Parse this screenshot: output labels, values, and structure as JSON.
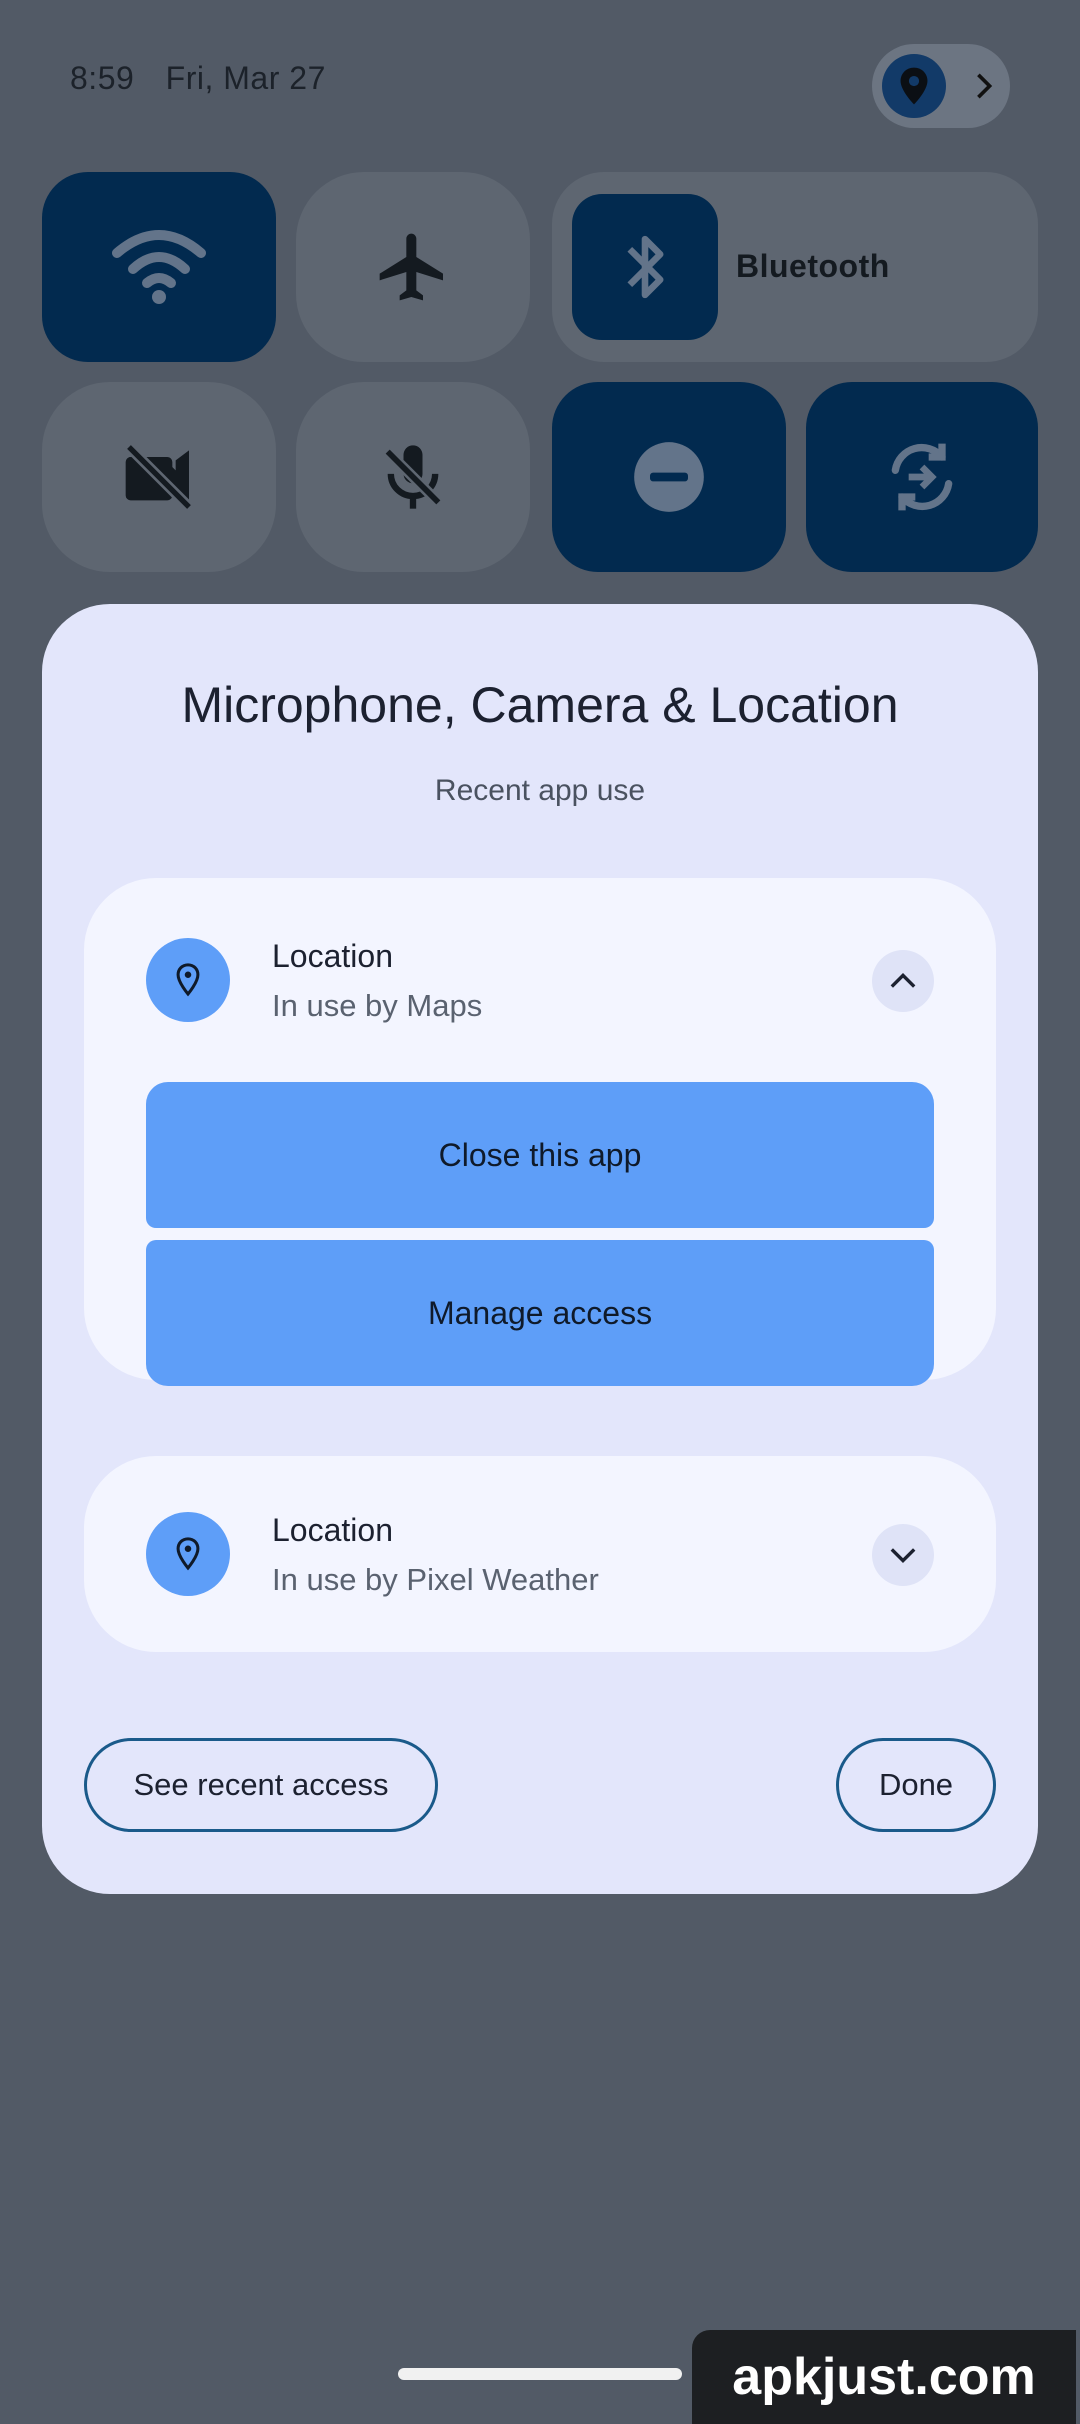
{
  "status_bar": {
    "time": "8:59",
    "date": "Fri, Mar 27"
  },
  "privacy_chip": {
    "icon": "location-pin-icon",
    "chevron": "chevron-right-icon"
  },
  "quick_tiles": [
    {
      "name": "wifi",
      "icon": "wifi-icon",
      "active": true
    },
    {
      "name": "airplane-mode",
      "icon": "airplane-icon",
      "active": false
    },
    {
      "name": "bluetooth",
      "icon": "bluetooth-icon",
      "label": "Bluetooth",
      "active": true
    },
    {
      "name": "camera-access",
      "icon": "camera-off-icon",
      "active": false
    },
    {
      "name": "microphone-access",
      "icon": "mic-off-icon",
      "active": false
    },
    {
      "name": "do-not-disturb",
      "icon": "dnd-icon",
      "active": true
    },
    {
      "name": "auto-rotate",
      "icon": "rotate-icon",
      "active": true
    }
  ],
  "dialog": {
    "title": "Microphone, Camera & Location",
    "subtitle": "Recent app use",
    "items": [
      {
        "title": "Location",
        "subtitle": "In use by Maps",
        "expanded": true,
        "actions": [
          "Close this app",
          "Manage access"
        ]
      },
      {
        "title": "Location",
        "subtitle": "In use by Pixel Weather",
        "expanded": false
      }
    ],
    "see_recent_label": "See recent access",
    "done_label": "Done"
  },
  "watermark": "apkjust.com",
  "colors": {
    "active_tile": "#022a4f",
    "inactive_tile": "#5e6671",
    "dialog_bg": "#e3e6fb",
    "accent": "#5e9ef8"
  }
}
